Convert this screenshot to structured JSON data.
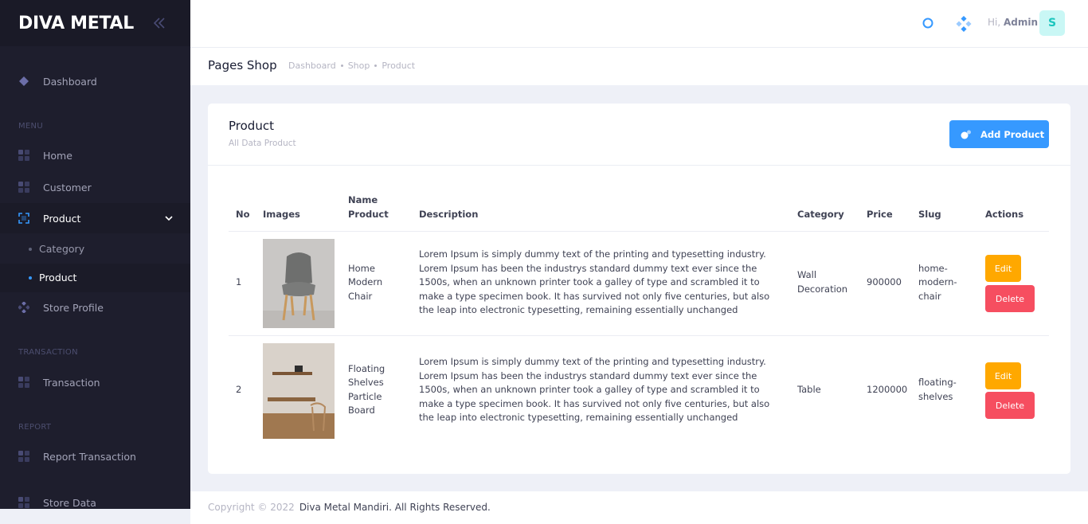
{
  "brand": {
    "name": "DIVA METAL"
  },
  "sidebar": {
    "dashboard": "Dashboard",
    "sections": {
      "menu": "MENU",
      "transaction": "TRANSACTION",
      "report": "REPORT"
    },
    "items": {
      "home": "Home",
      "customer": "Customer",
      "product": "Product",
      "category": "Category",
      "product_sub": "Product",
      "store_profile": "Store Profile",
      "transaction": "Transaction",
      "report_transaction": "Report Transaction",
      "partial": "Store Data"
    }
  },
  "header": {
    "greeting": "Hi,",
    "user": "Admin",
    "avatar_letter": "S"
  },
  "subheader": {
    "title": "Pages Shop",
    "breadcrumbs": [
      "Dashboard",
      "Shop",
      "Product"
    ]
  },
  "card": {
    "title": "Product",
    "subtitle": "All Data Product",
    "add_button": "Add Product"
  },
  "table": {
    "headers": {
      "no": "No",
      "images": "Images",
      "name_1": "Name",
      "name_2": "Product",
      "description": "Description",
      "category": "Category",
      "price": "Price",
      "slug": "Slug",
      "actions": "Actions"
    },
    "rows": [
      {
        "no": "1",
        "name_lines": [
          "Home",
          "Modern",
          "Chair"
        ],
        "description_lines": [
          "Lorem Ipsum is simply dummy text of the printing and typesetting industry.",
          "Lorem Ipsum has been the industrys standard dummy text ever since the",
          "1500s, when an unknown printer took a galley of type and scrambled it to",
          "make a type specimen book. It has survived not only five centuries, but also",
          "the leap into electronic typesetting, remaining essentially unchanged"
        ],
        "category_lines": [
          "Wall",
          "Decoration"
        ],
        "price": "900000",
        "slug_lines": [
          "home-",
          "modern-",
          "chair"
        ],
        "edit": "Edit",
        "delete": "Delete"
      },
      {
        "no": "2",
        "name_lines": [
          "Floating",
          "Shelves",
          "Particle",
          "Board"
        ],
        "description_lines": [
          "Lorem Ipsum is simply dummy text of the printing and typesetting industry.",
          "Lorem Ipsum has been the industrys standard dummy text ever since the",
          "1500s, when an unknown printer took a galley of type and scrambled it to",
          "make a type specimen book. It has survived not only five centuries, but also",
          "the leap into electronic typesetting, remaining essentially unchanged"
        ],
        "category_lines": [
          "Table"
        ],
        "price": "1200000",
        "slug_lines": [
          "floating-",
          "shelves"
        ],
        "edit": "Edit",
        "delete": "Delete"
      }
    ]
  },
  "footer": {
    "copyright": "Copyright © 2022",
    "company": "Diva Metal Mandiri. All Rights Reserved."
  },
  "colors": {
    "primary": "#3699ff",
    "warning": "#ffa800",
    "danger": "#f64e60",
    "sidebar": "#1e1e2d"
  }
}
